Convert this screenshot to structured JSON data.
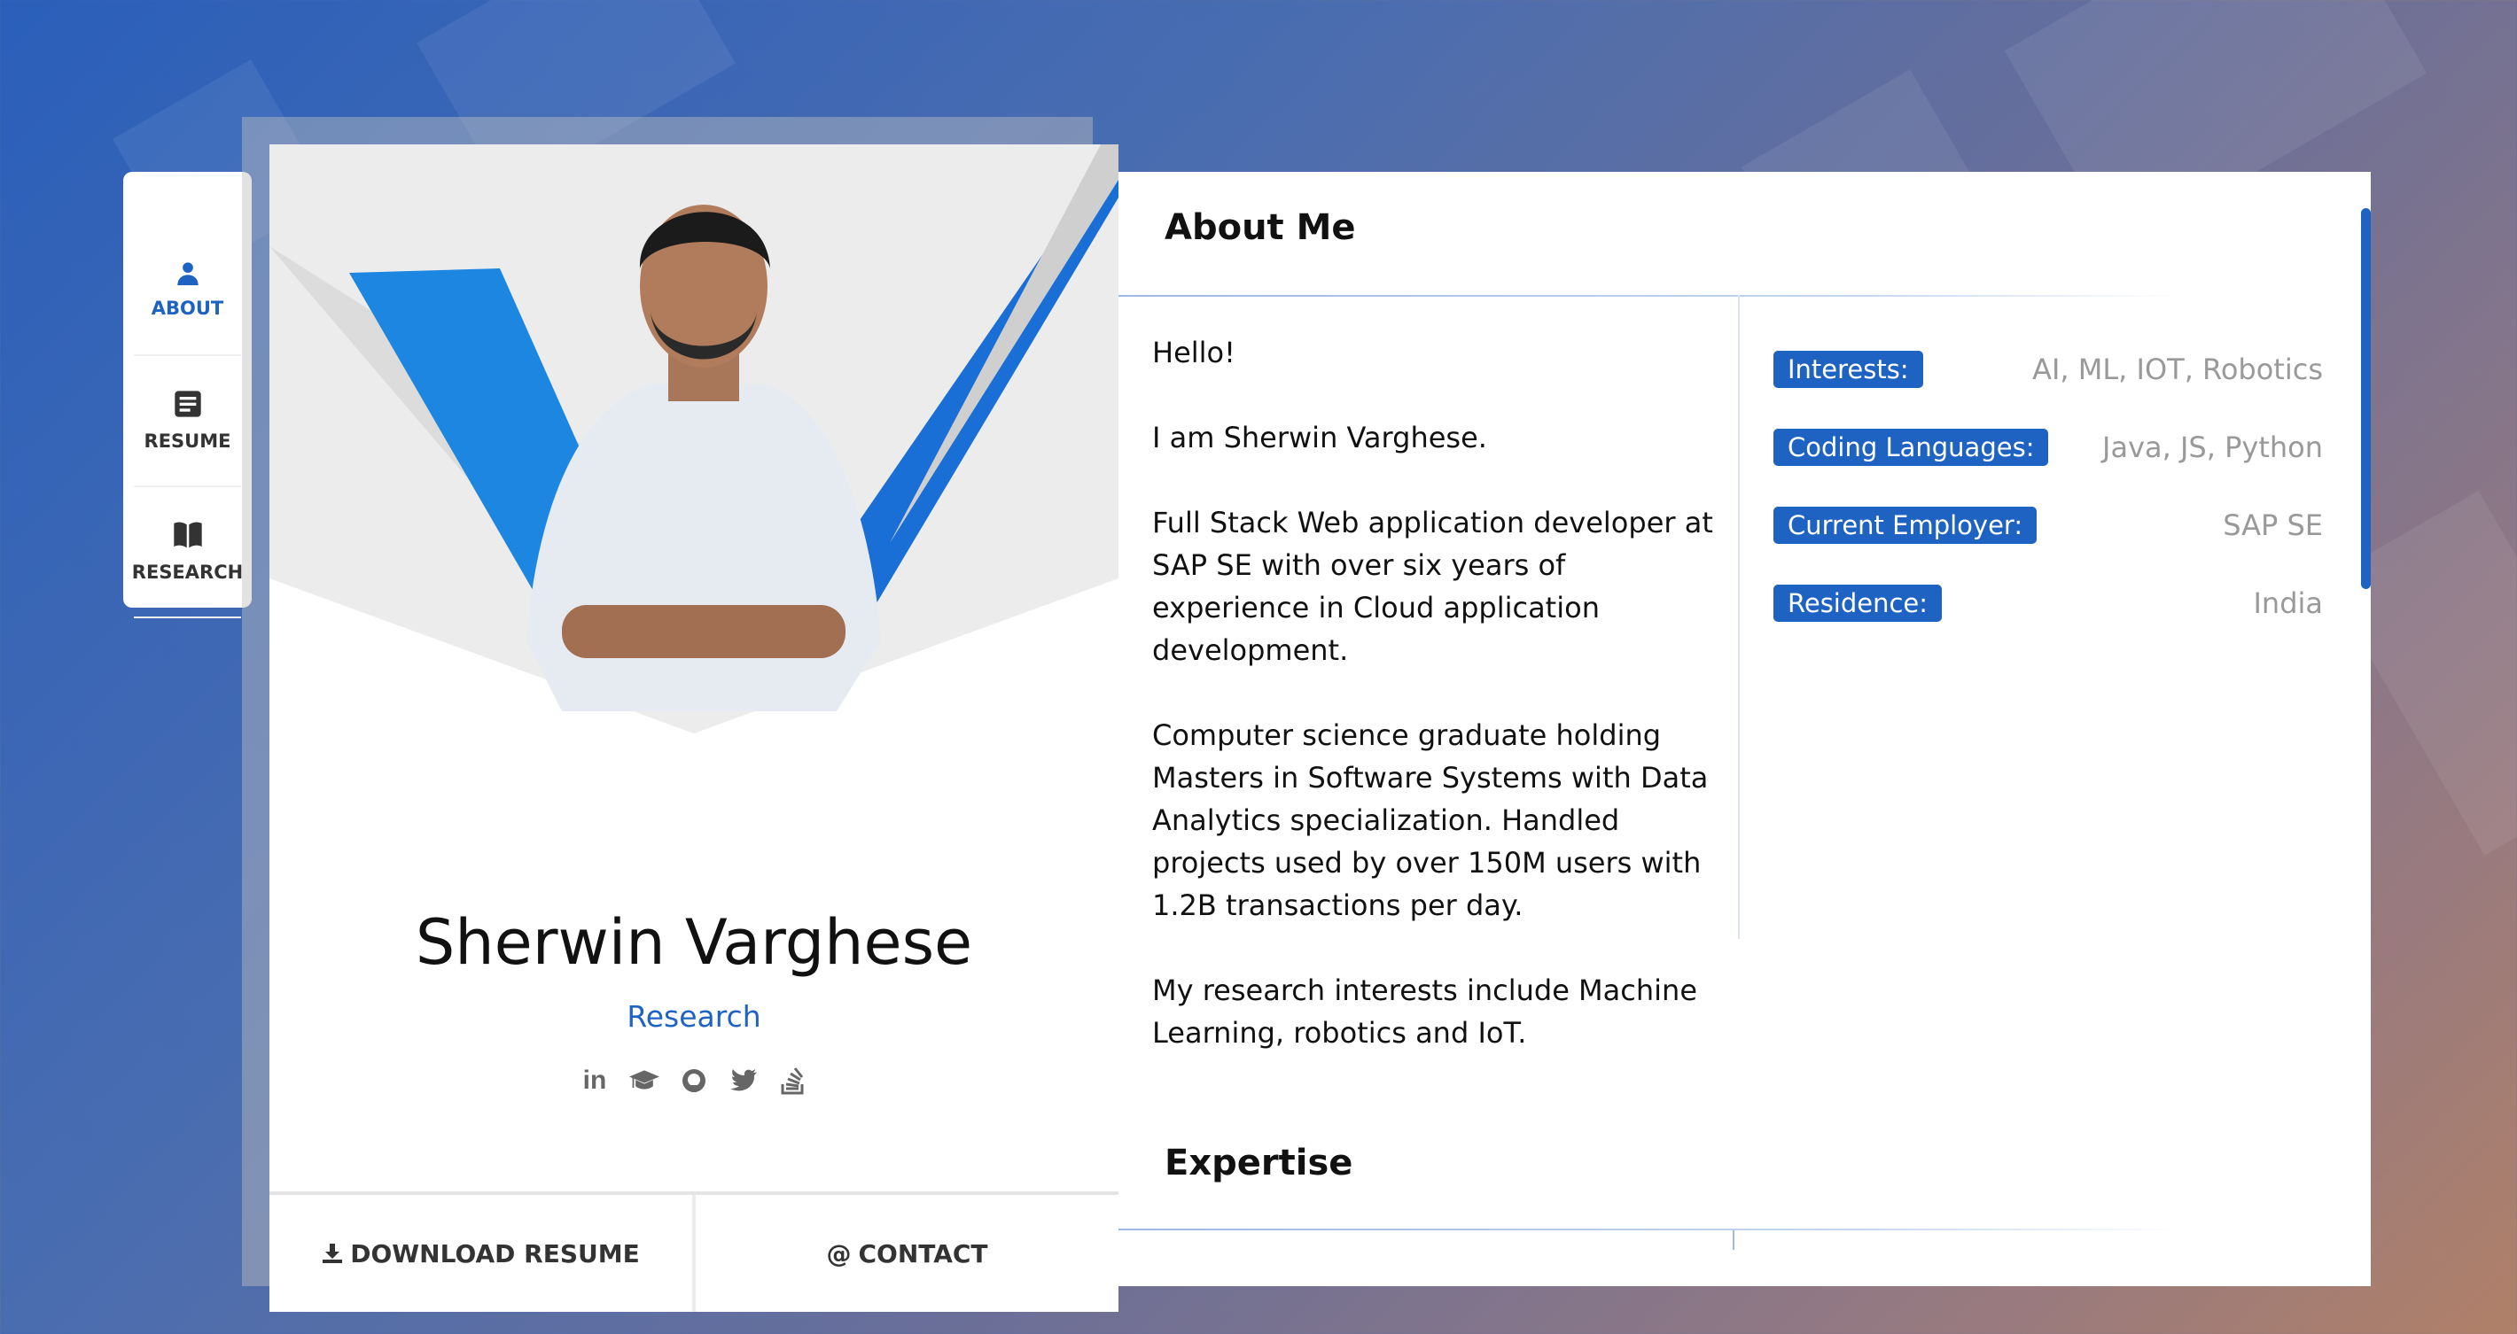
{
  "nav": {
    "items": [
      {
        "label": "ABOUT",
        "icon": "user-icon",
        "active": true
      },
      {
        "label": "RESUME",
        "icon": "document-icon",
        "active": false
      },
      {
        "label": "RESEARCH",
        "icon": "book-icon",
        "active": false
      }
    ]
  },
  "profile": {
    "name": "Sherwin Varghese",
    "role": "Research",
    "socials": [
      "linkedin-icon",
      "graduation-cap-icon",
      "github-icon",
      "twitter-icon",
      "stackoverflow-icon"
    ],
    "download_label": "DOWNLOAD RESUME",
    "contact_label": "CONTACT",
    "contact_symbol": "@"
  },
  "about": {
    "title": "About Me",
    "paragraphs": [
      "Hello!",
      "I am Sherwin Varghese.",
      "Full Stack Web application developer at SAP SE with over six years of experience in Cloud application development.",
      "Computer science graduate holding Masters in Software Systems with Data Analytics specialization. Handled projects used by over 150M users with 1.2B transactions per day.",
      "My research interests include Machine Learning, robotics and IoT."
    ],
    "facts": [
      {
        "label": "Interests:",
        "value": "AI, ML, IOT, Robotics"
      },
      {
        "label": "Coding Languages:",
        "value": "Java, JS, Python"
      },
      {
        "label": "Current Employer:",
        "value": "SAP SE"
      },
      {
        "label": "Residence:",
        "value": "India"
      }
    ]
  },
  "expertise": {
    "title": "Expertise"
  },
  "colors": {
    "accent": "#1e63c2",
    "text": "#111111",
    "muted": "#999999"
  }
}
